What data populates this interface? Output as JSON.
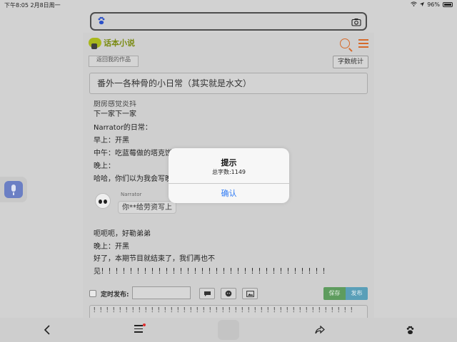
{
  "status_bar": {
    "time_date": "下午8:05   2月8日周一",
    "battery": "96%"
  },
  "page": {
    "logo_text": "话本小说",
    "back_button": "返回我的作品",
    "word_count_button": "字数统计",
    "chapter_title": "番外一各种骨的小日常（其实就是水文）",
    "editor": {
      "cut_line": "厨房感觉炎抖",
      "lines": [
        "下一家下一家",
        "Narrator的日常：",
        "早上：开黑",
        "中午：吃蓝莓做的塔克饼",
        "晚上：",
        "哈哈，你们以为我会写晚"
      ],
      "narrator_name": "Narrator",
      "narrator_bubble": "你**给劳资写上",
      "after_lines": [
        "呃呃呃，好勒弟弟",
        "晚上：开黑",
        "好了，本期节目就结束了，我们再也不",
        "见！！！！！！！！！！！！！！！！！！！！！！！！！！！！！！！！"
      ]
    },
    "schedule_label": "定时发布:",
    "save_button": "保存",
    "publish_button": "发布",
    "second_box_text": "！！！！！！！！！！！！！！！！！！！！！！！！！！！！！！！！！！！！！！！！！"
  },
  "dialog": {
    "title": "提示",
    "message": "总字数:1149",
    "confirm": "确认"
  },
  "colors": {
    "accent_orange": "#d66a2b",
    "link_blue": "#2f7bf6",
    "save_green": "#5e9c5e",
    "publish_blue": "#5a9fb8"
  },
  "icons": [
    "wifi-icon",
    "battery-icon",
    "baidu-paw-icon",
    "camera-icon",
    "search-icon",
    "menu-icon",
    "chat-icon",
    "github-icon",
    "image-icon",
    "mic-icon",
    "back-arrow-icon",
    "share-icon"
  ]
}
